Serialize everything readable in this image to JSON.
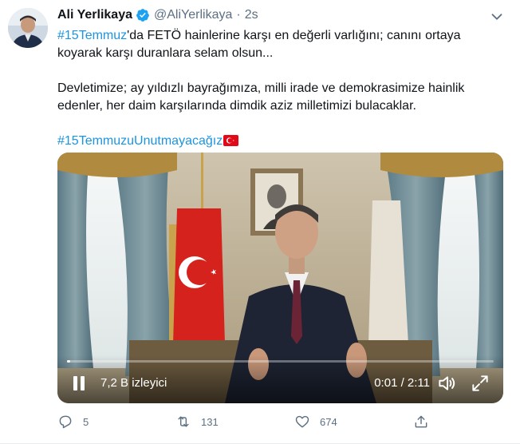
{
  "tweet": {
    "author_name": "Ali Yerlikaya",
    "handle": "@AliYerlikaya",
    "separator": "·",
    "time": "2s",
    "line1_hashtag": "#15Temmuz",
    "line1_rest": "'da FETÖ hainlerine karşı en değerli varlığını; canını ortaya koyarak karşı duranlara selam olsun...",
    "paragraph2": "Devletimize; ay yıldızlı bayrağımıza, milli irade ve demokrasimize hainlik edenler, her daim karşılarında dimdik aziz milletimizi bulacaklar.",
    "hashtag2": "#15TemmuzuUnutmayacağız",
    "flag_icon": "turkey-flag-emoji"
  },
  "video": {
    "views": "7,2 B izleyici",
    "timecode": "0:01 / 2:11",
    "progress": 0.008,
    "play_icon": "pause-icon",
    "volume_icon": "volume-icon",
    "fullscreen_icon": "fullscreen-icon"
  },
  "actions": {
    "reply_count": "5",
    "retweet_count": "131",
    "like_count": "674"
  },
  "colors": {
    "link": "#1b95e0",
    "secondary": "#5b7083",
    "verified": "#1da1f2"
  }
}
